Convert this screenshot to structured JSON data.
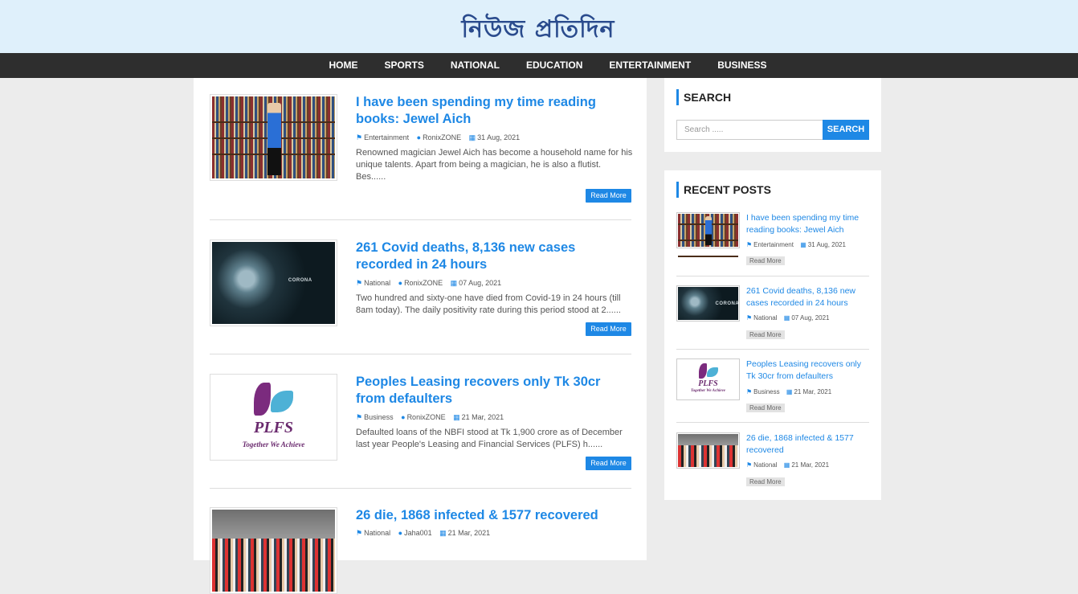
{
  "site": {
    "logo_text": "নিউজ প্রতিদিন"
  },
  "nav": {
    "items": [
      "HOME",
      "SPORTS",
      "NATIONAL",
      "EDUCATION",
      "ENTERTAINMENT",
      "BUSINESS"
    ]
  },
  "posts": [
    {
      "title": "I have been spending my time reading books: Jewel Aich",
      "category": "Entertainment",
      "author": "RonixZONE",
      "date": "31 Aug, 2021",
      "excerpt": "Renowned magician Jewel Aich has become a household name for his unique talents. Apart from being a magician, he is also a flutist. Bes......",
      "read_more": "Read More",
      "image": "books"
    },
    {
      "title": "261 Covid deaths, 8,136 new cases recorded in 24 hours",
      "category": "National",
      "author": "RonixZONE",
      "date": "07 Aug, 2021",
      "excerpt": "Two hundred and sixty-one have died from Covid-19 in 24 hours (till 8am today). The daily positivity rate during this period stood at 2......",
      "read_more": "Read More",
      "image": "corona"
    },
    {
      "title": "Peoples Leasing recovers only Tk 30cr from defaulters",
      "category": "Business",
      "author": "RonixZONE",
      "date": "21 Mar, 2021",
      "excerpt": "Defaulted loans of the NBFI stood at Tk 1,900 crore as of December last year People's Leasing and Financial Services (PLFS) h......",
      "read_more": "Read More",
      "image": "plfs"
    },
    {
      "title": "26 die, 1868 infected & 1577 recovered",
      "category": "National",
      "author": "Jaha001",
      "date": "21 Mar, 2021",
      "image": "crowd"
    }
  ],
  "sidebar": {
    "search": {
      "title": "SEARCH",
      "placeholder": "Search .....",
      "button": "SEARCH"
    },
    "recent": {
      "title": "RECENT POSTS",
      "items": [
        {
          "title": "I have been spending my time reading books: Jewel Aich",
          "category": "Entertainment",
          "date": "31 Aug, 2021",
          "read_more": "Read More"
        },
        {
          "title": "261 Covid deaths, 8,136 new cases recorded in 24 hours",
          "category": "National",
          "date": "07 Aug, 2021",
          "read_more": "Read More"
        },
        {
          "title": "Peoples Leasing recovers only Tk 30cr from defaulters",
          "category": "Business",
          "date": "21 Mar, 2021",
          "read_more": "Read More"
        },
        {
          "title": "26 die, 1868 infected & 1577 recovered",
          "category": "National",
          "date": "21 Mar, 2021",
          "read_more": "Read More"
        }
      ]
    }
  },
  "image_text": {
    "corona": "CORONA",
    "plfs_brand": "PLFS",
    "plfs_slogan": "Together We Achieve"
  },
  "colors": {
    "accent": "#1e88e5",
    "nav_bg": "#2e2e2e",
    "banner_bg": "#dff0fb",
    "page_bg": "#ececec"
  }
}
